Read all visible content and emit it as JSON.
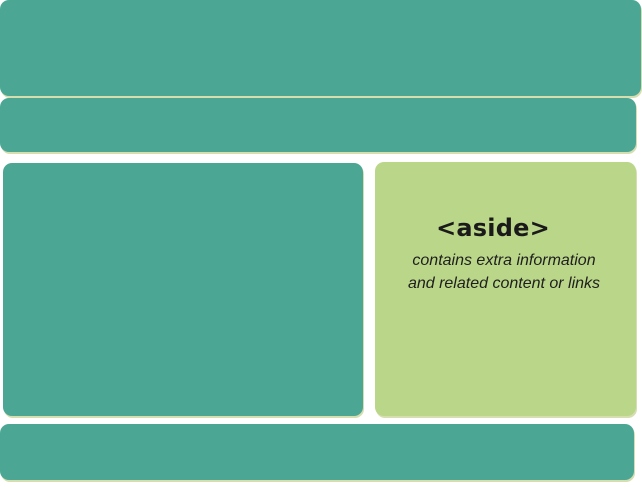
{
  "regions": {
    "header": {
      "color": "#4ba794"
    },
    "nav": {
      "color": "#4ba794"
    },
    "main": {
      "color": "#4ba794"
    },
    "aside": {
      "color": "#bad689",
      "title": "<aside>",
      "description_line1": "contains extra information",
      "description_line2": "and related content or links"
    },
    "footer": {
      "color": "#4ba794"
    }
  }
}
